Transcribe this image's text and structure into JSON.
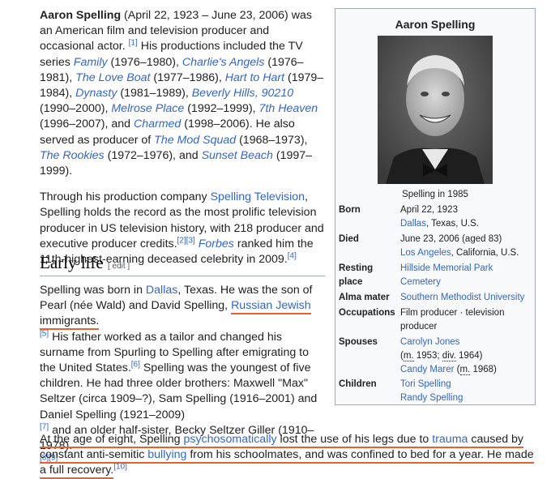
{
  "lead": {
    "p1": {
      "name": "Aaron Spelling",
      "t1": " (April 22, 1923 – June 23, 2006) was an American film and television producer and occasional actor.",
      "ref1": "[1]",
      "t2": " His productions included the TV series ",
      "family": "Family",
      "t3": " (1976–1980), ",
      "charlies": "Charlie's Angels",
      "t4": " (1976–1981), ",
      "loveboat": "The Love Boat",
      "t5": " (1977–1986), ",
      "harttohart": "Hart to Hart",
      "t6": " (1979–1984), ",
      "dynasty": "Dynasty",
      "t7": " (1981–1989), ",
      "beverly": "Beverly Hills, 90210",
      "t8": " (1990–2000), ",
      "melrose": "Melrose Place",
      "t9": " (1992–1999), ",
      "seventh": "7th Heaven",
      "t10": " (1996–2007), and ",
      "charmed": "Charmed",
      "t11": " (1998–2006). He also served as producer of ",
      "modsquad": "The Mod Squad",
      "t12": " (1968–1973), ",
      "rookies": "The Rookies",
      "t13": " (1972–1976), and ",
      "sunset": "Sunset Beach",
      "t14": " (1997–1999)."
    },
    "p2": {
      "t1": "Through his production company ",
      "company": "Spelling Television",
      "t2": ", Spelling holds the record as the most prolific television producer in US television history, with 218 producer and executive producer credits.",
      "ref23": "[2][3]",
      "forbes": "Forbes",
      "t3": " ranked him the 11th-highest-earning deceased celebrity in 2009.",
      "ref4": "[4]"
    }
  },
  "early_life": {
    "heading": "Early life",
    "edit": "[ edit ]",
    "p1": {
      "t1": "Spelling was born in ",
      "dallas": "Dallas",
      "t2": ", Texas. He was the son of Pearl (née Wald) and David Spelling, ",
      "russian": "Russian Jewish",
      "t3": " immigrants.",
      "ref5": "[5]",
      "t4": " His father worked as a tailor and changed his surname from Spurling to Spelling after emigrating to the United States.",
      "ref6": "[6]",
      "t5": " Spelling was the youngest of five children. He had three older brothers: Maxwell \"Max\" Seltzer (circa 1909–?), Sam Spelling (1916–2001) and Daniel Spelling (1921–2009)",
      "ref7": "[7]",
      "t6": " and an older half-sister, Becky Seltzer Giller (1910–1978).",
      "ref89": "[8][9]"
    },
    "p2": {
      "t1": "At the age of eight, Spelling ",
      "psycho": "psychosomatically",
      "t2": " lost the use of his legs due to ",
      "trauma": "trauma",
      "t3": " caused by constant anti-semitic ",
      "bullying": "bullying",
      "t4": " from his schoolmates, and was confined to bed for a year. He made a full recovery.",
      "ref10": "[10]"
    }
  },
  "infobox": {
    "title": "Aaron Spelling",
    "caption": "Spelling in 1985",
    "born_label": "Born",
    "born_date": "April 22, 1923",
    "born_city": "Dallas",
    "born_rest": ", Texas, U.S.",
    "died_label": "Died",
    "died_date": "June 23, 2006 (aged 83)",
    "died_city": "Los Angeles",
    "died_rest": ", California, U.S.",
    "resting_label": "Resting place",
    "resting_value": "Hillside Memorial Park Cemetery",
    "alma_label": "Alma mater",
    "alma_value": "Southern Methodist University",
    "occ_label": "Occupations",
    "occ_value": "Film producer · television producer",
    "spouses_label": "Spouses",
    "spouse1": "Carolyn Jones",
    "spouse1_m_open": "(",
    "spouse1_m": "m.",
    "spouse1_mid": " 1953; ",
    "spouse1_div": "div.",
    "spouse1_end": " 1964)",
    "spouse2": "Candy Marer",
    "spouse2_m_open": " (",
    "spouse2_m": "m.",
    "spouse2_end": " 1968)",
    "children_label": "Children",
    "child1": "Tori Spelling",
    "child2": "Randy Spelling"
  }
}
